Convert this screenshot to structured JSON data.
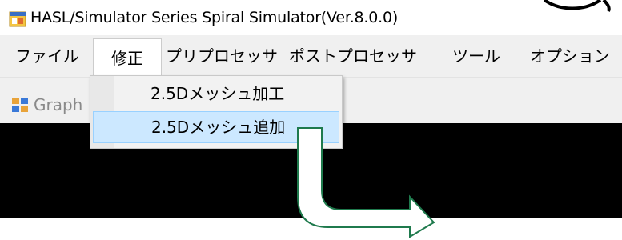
{
  "window": {
    "title": "HASL/Simulator Series Spiral Simulator(Ver.8.0.0)",
    "app_icon": "window-app-icon"
  },
  "menubar": {
    "items": [
      {
        "label": "ファイル"
      },
      {
        "label": "修正"
      },
      {
        "label": "プリプロセッサ"
      },
      {
        "label": "ポストプロセッサ"
      },
      {
        "label": "ツール"
      },
      {
        "label": "オプション"
      }
    ]
  },
  "toolbar": {
    "graph_label": "Graph",
    "graph_icon": "graph-window-icon"
  },
  "dropdown": {
    "items": [
      {
        "label": "2.5Dメッシュ加工",
        "highlighted": false
      },
      {
        "label": "2.5Dメッシュ追加",
        "highlighted": true
      }
    ]
  },
  "colors": {
    "highlight_bg": "#cce8ff",
    "highlight_border": "#99d1ff",
    "arrow_stroke": "#1f7a4d",
    "canvas_bg": "#000000"
  }
}
